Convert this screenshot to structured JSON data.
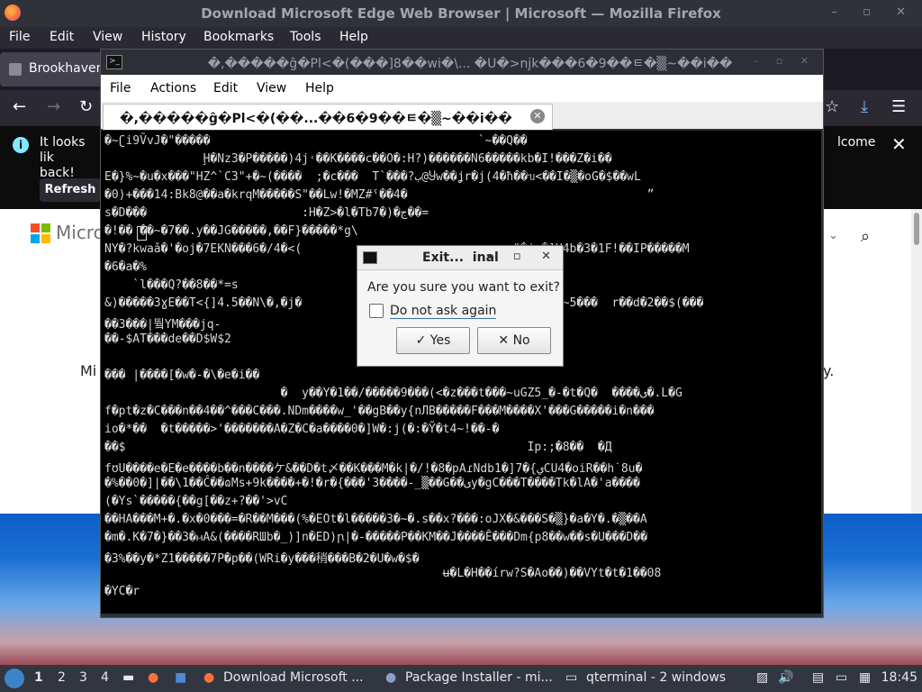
{
  "firefox": {
    "window_title": "Download Microsoft Edge Web Browser | Microsoft — Mozilla Firefox",
    "menu": [
      "File",
      "Edit",
      "View",
      "History",
      "Bookmarks",
      "Tools",
      "Help"
    ],
    "tab_label": "Brookhaven",
    "notification": {
      "message": "It looks lik back!",
      "line1": "It looks lik",
      "line2": "back!",
      "refresh": "Refresh",
      "welcome_fragment": "lcome"
    },
    "page": {
      "ms_text": "Micro",
      "body_left": "Mi",
      "body_right": "y."
    }
  },
  "qterminal": {
    "window_title": "�,�����ĝ�Pl<�(���]8��wi�\\... �U�>njk���6�9��ㅌ�▒~��i��",
    "menu": [
      "File",
      "Actions",
      "Edit",
      "View",
      "Help"
    ],
    "tab_label": "�,�����ĝ�Pl<�(��...��6�9��ㅌ�▒~��i��",
    "lines": [
      "�~ʗi9V̄vJ�\"�����                                      `~��Q��",
      "              Ḩ�Nz3�P�����)4j˓��K����c��O�:H?)������N6�����kb�I!���Z�i��",
      "E�}%~�u�x���\"HZ^`C3\"+�~(����  ;�c���  T`���?ب@Ⴘw��ʝr�j(4�ħ��ᥔ<��I�▒�oG�$��wL",
      "�0)+���14:Bk8@��a�krqM�����S\"��Lw!�MZ#ˤ��4�                                  ˮ",
      "s�D���                      :H�Z>�l�Tb7�)�ج��=",
      "�!�� ��~�7��.y��JG�����,��F}�����*g\\",
      "NY�?kwaǎ�'�oj�7EKN���6�/4�<(                              \"�j>�]Y4b�3�1F!��IP�����M",
      "�6�a�%",
      "    `l���Q?��8��*=s",
      "&)�����3ɣE��T<{]4.5��N\\�,�j�                              �mq����~5���  r��d�2��$(���",
      "��3���|뛐YM���jq-",
      "��-$AT���de��D$W$2",
      "",
      "��� |����[�w�-�\\�e�i��",
      "                         �  y��Y�1��/�����9���(<�z���t���~uGZ5_�-�t�Q�  ����ى�.L�G",
      "f�pt�z�C���n��4��^���C���.NDm����w_'��gB��y{nЛB�����F���M����X'���G�����i�n���",
      "io�*��  �t�����>'�������A�Z�C�a����0�]W�:j(�:�Y̆�t4~!��-�",
      "��$                                                         Ip:;�8��  �Д",
      "fʊU����e�E�e����b��n����ケ&��D�t〆��K���M�k|�/!�8�pAɾNdb1�]7�{يCU4�oiR��h˙8u�",
      "�%��0�]|��\\1��Ĉ��ɷMs+9k����+�!�r�{���'3����-_▒��G��ىy�gC���T����Tk�lA�'a����",
      "(�Ys`�����{��g[��z+?��'>vC",
      "��HA���M+�.�x�0���=�R��M���(%�EOt�l�����3�~�.s��x?���:oJX�&���S�▒}�a�Y�.�▒��A",
      "�m�.K�7�}��3�ⲙA&(����RШb�_)]n�ED)ꞃ|�-�����P��KM��J����Ê���Dm{p8��w��s�U���D��",
      "�3%��y�*Z1�����7P�p��(WRi�y���稍���B�2�U�w�$�",
      "                                                ʉ�L�H��írw?S�Ao��)��VYt�t�1��08",
      "�YC�r"
    ]
  },
  "dialog": {
    "title_left": "Exit...",
    "title_right": "inal",
    "question": "Are you sure you want to exit?",
    "checkbox_label": "Do not ask again",
    "yes": "Yes",
    "no": "No"
  },
  "taskbar": {
    "workspaces": [
      "1",
      "2",
      "3",
      "4"
    ],
    "tasks": [
      "Download Microsoft ...",
      "Package Installer - mi...",
      "qterminal - 2 windows"
    ],
    "clock": "18:45"
  }
}
